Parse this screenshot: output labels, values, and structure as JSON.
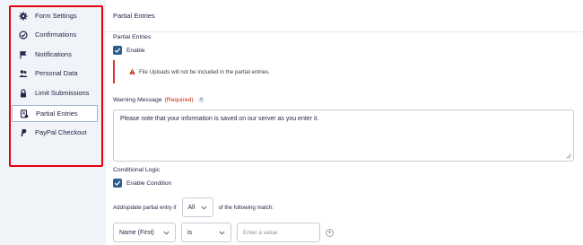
{
  "sidebar": {
    "items": [
      {
        "label": "Form Settings",
        "icon": "gear-icon"
      },
      {
        "label": "Confirmations",
        "icon": "check-circle-icon"
      },
      {
        "label": "Notifications",
        "icon": "flag-icon"
      },
      {
        "label": "Personal Data",
        "icon": "users-icon"
      },
      {
        "label": "Limit Submissions",
        "icon": "lock-icon"
      },
      {
        "label": "Partial Entries",
        "icon": "partial-entries-icon",
        "active": true
      },
      {
        "label": "PayPal Checkout",
        "icon": "paypal-icon"
      }
    ],
    "highlight_color": "#e3000f"
  },
  "main": {
    "title": "Partial Entries",
    "partial_entries_label": "Partial Entries",
    "enable_label": "Enable",
    "enable_checked": true,
    "notice_text": "File Uploads will not be included in the partial entries.",
    "warning_label": "Warning Message",
    "required_text": "(Required)",
    "help_glyph": "?",
    "warning_message": "Please note that your information is saved on our server as you enter it.",
    "conditional_logic_label": "Conditional Logic",
    "enable_condition_label": "Enable Condition",
    "enable_condition_checked": true,
    "sentence_prefix": "Add/update partial entry if",
    "match_select_value": "All",
    "sentence_suffix": "of the following match:",
    "rule": {
      "field_value": "Name (First)",
      "operator_value": "is",
      "value_placeholder": "Enter a value",
      "add_glyph": "+"
    }
  },
  "colors": {
    "accent": "#2c5d8f",
    "required": "#c02b0a",
    "notice_border": "#d63638"
  }
}
